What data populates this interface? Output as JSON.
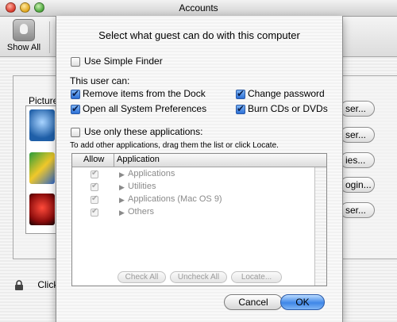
{
  "window": {
    "title": "Accounts"
  },
  "toolbar": {
    "show_all_label": "Show All",
    "show_all_icon": "apple-icon"
  },
  "background": {
    "pictures_header": "Picture",
    "user_buttons": [
      "ser...",
      "ser...",
      "ies...",
      "ogin...",
      "ser..."
    ],
    "lock_text": "Click"
  },
  "sheet": {
    "title": "Select what guest can do with this computer",
    "use_simple_finder": {
      "label": "Use Simple Finder",
      "checked": false
    },
    "this_user_can_label": "This user can:",
    "permissions": [
      {
        "label": "Remove items from the Dock",
        "checked": true
      },
      {
        "label": "Change password",
        "checked": true
      },
      {
        "label": "Open all System Preferences",
        "checked": true
      },
      {
        "label": "Burn CDs or DVDs",
        "checked": true
      }
    ],
    "use_only_apps": {
      "label": "Use only these applications:",
      "checked": false
    },
    "hint": "To add other applications, drag them the list or click Locate.",
    "table": {
      "columns": [
        "Allow",
        "Application"
      ],
      "rows": [
        {
          "allow": true,
          "name": "Applications"
        },
        {
          "allow": true,
          "name": "Utilities"
        },
        {
          "allow": true,
          "name": "Applications (Mac OS 9)"
        },
        {
          "allow": true,
          "name": "Others"
        }
      ]
    },
    "buttons": {
      "check_all": "Check All",
      "uncheck_all": "Uncheck All",
      "locate": "Locate...",
      "cancel": "Cancel",
      "ok": "OK"
    }
  }
}
